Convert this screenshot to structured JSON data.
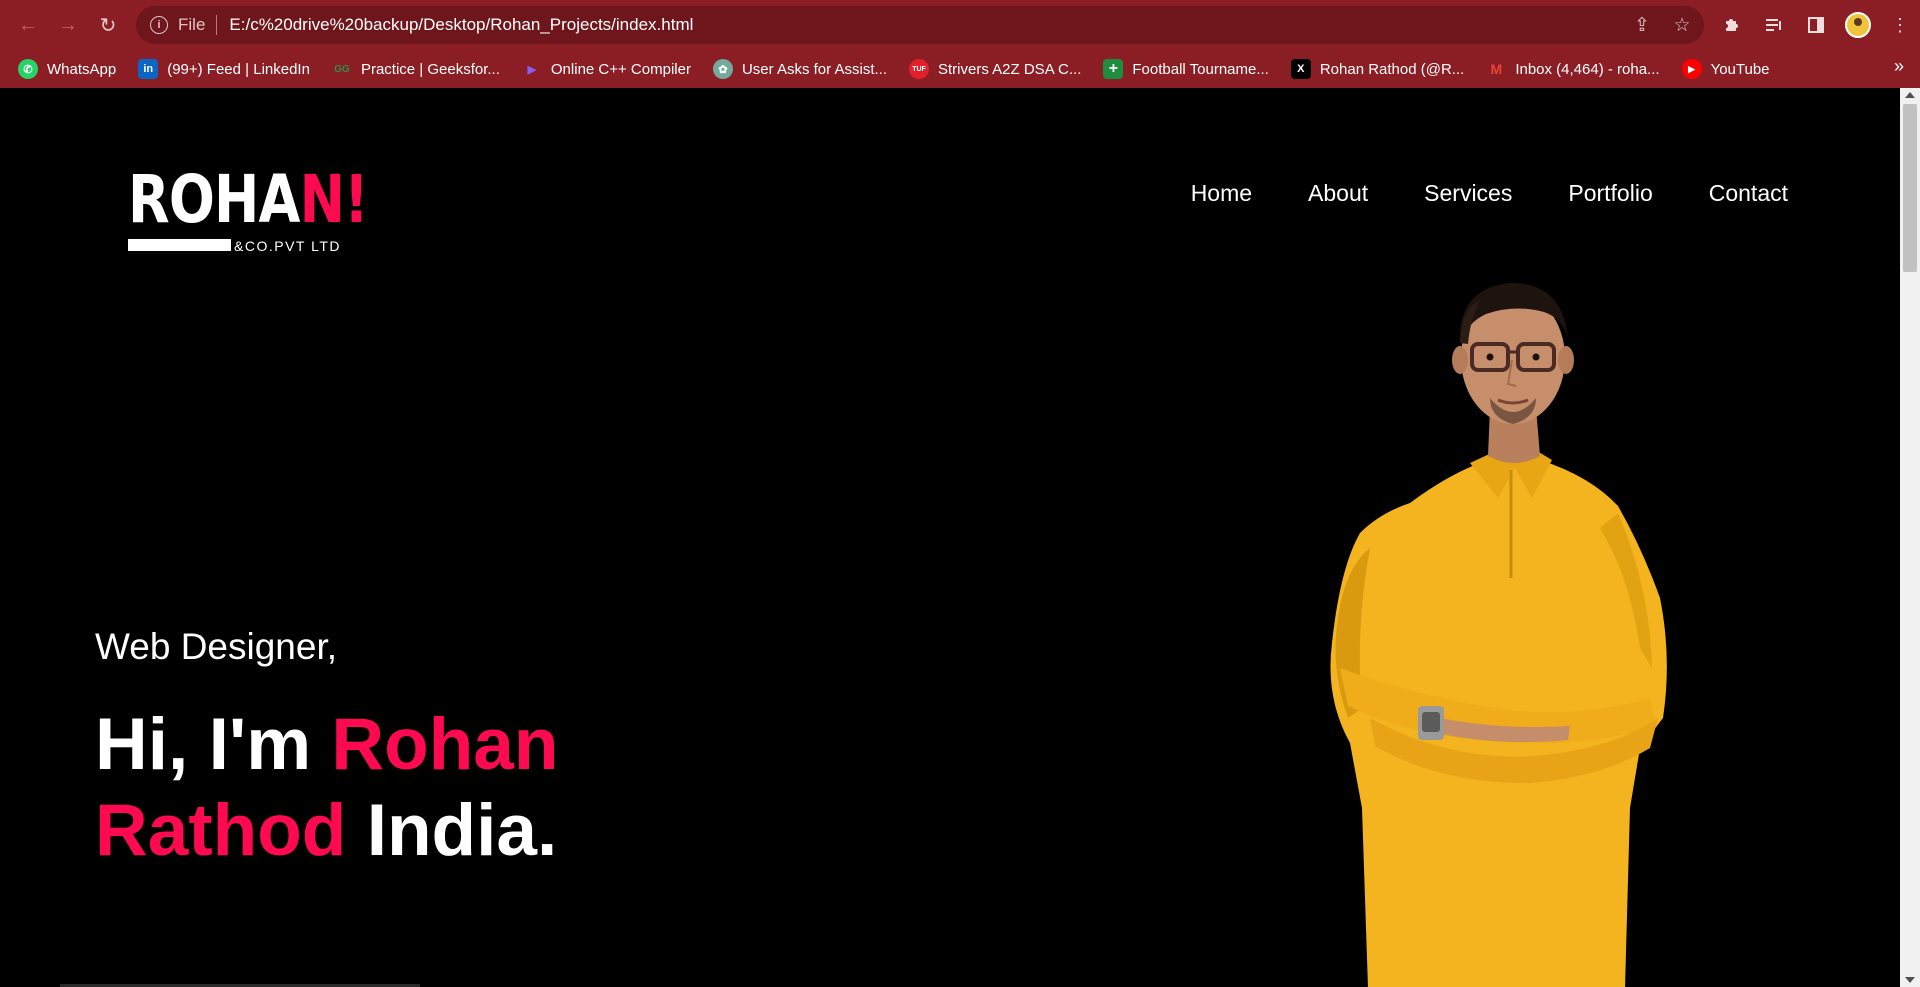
{
  "browser": {
    "back_icon": "arrow-left-icon",
    "forward_icon": "arrow-right-icon",
    "reload_icon": "reload-icon",
    "omnibox": {
      "scheme_label": "File",
      "url": "E:/c%20drive%20backup/Desktop/Rohan_Projects/index.html"
    },
    "bookmarks": [
      {
        "label": "WhatsApp",
        "icon": "whatsapp-icon",
        "color": "#25d366",
        "glyph": "✆"
      },
      {
        "label": "(99+) Feed | LinkedIn",
        "icon": "linkedin-icon",
        "color": "#0a66c2",
        "glyph": "in"
      },
      {
        "label": "Practice | Geeksfor...",
        "icon": "geeksforgeeks-icon",
        "color": "#2f8d46",
        "glyph": "GG"
      },
      {
        "label": "Online C++ Compiler",
        "icon": "compiler-icon",
        "color": "#6a3de8",
        "glyph": "▶"
      },
      {
        "label": "User Asks for Assist...",
        "icon": "chatgpt-icon",
        "color": "#74aa9c",
        "glyph": "✿"
      },
      {
        "label": "Strivers A2Z DSA C...",
        "icon": "tuf-icon",
        "color": "#e0202a",
        "glyph": "TUF"
      },
      {
        "label": "Football Tourname...",
        "icon": "sheets-icon",
        "color": "#1e8e3e",
        "glyph": "+"
      },
      {
        "label": "Rohan Rathod (@R...",
        "icon": "x-icon",
        "color": "#000000",
        "glyph": "X"
      },
      {
        "label": "Inbox (4,464) - roha...",
        "icon": "gmail-icon",
        "color": "#ea4335",
        "glyph": "M"
      },
      {
        "label": "YouTube",
        "icon": "youtube-icon",
        "color": "#ff0000",
        "glyph": "▶"
      }
    ]
  },
  "site": {
    "logo": {
      "main": "ROHA",
      "accent": "N!",
      "sub": "&CO.PVT LTD"
    },
    "nav": [
      "Home",
      "About",
      "Services",
      "Portfolio",
      "Contact"
    ],
    "hero": {
      "subtitle": "Web Designer,",
      "line1_prefix": "Hi, I'm ",
      "line1_accent": "Rohan",
      "line2_accent": "Rathod",
      "line2_suffix": " India."
    },
    "colors": {
      "accent": "#ff0a50",
      "background": "#000000",
      "chrome": "#8b1e24",
      "shirt": "#f4b41f"
    }
  }
}
